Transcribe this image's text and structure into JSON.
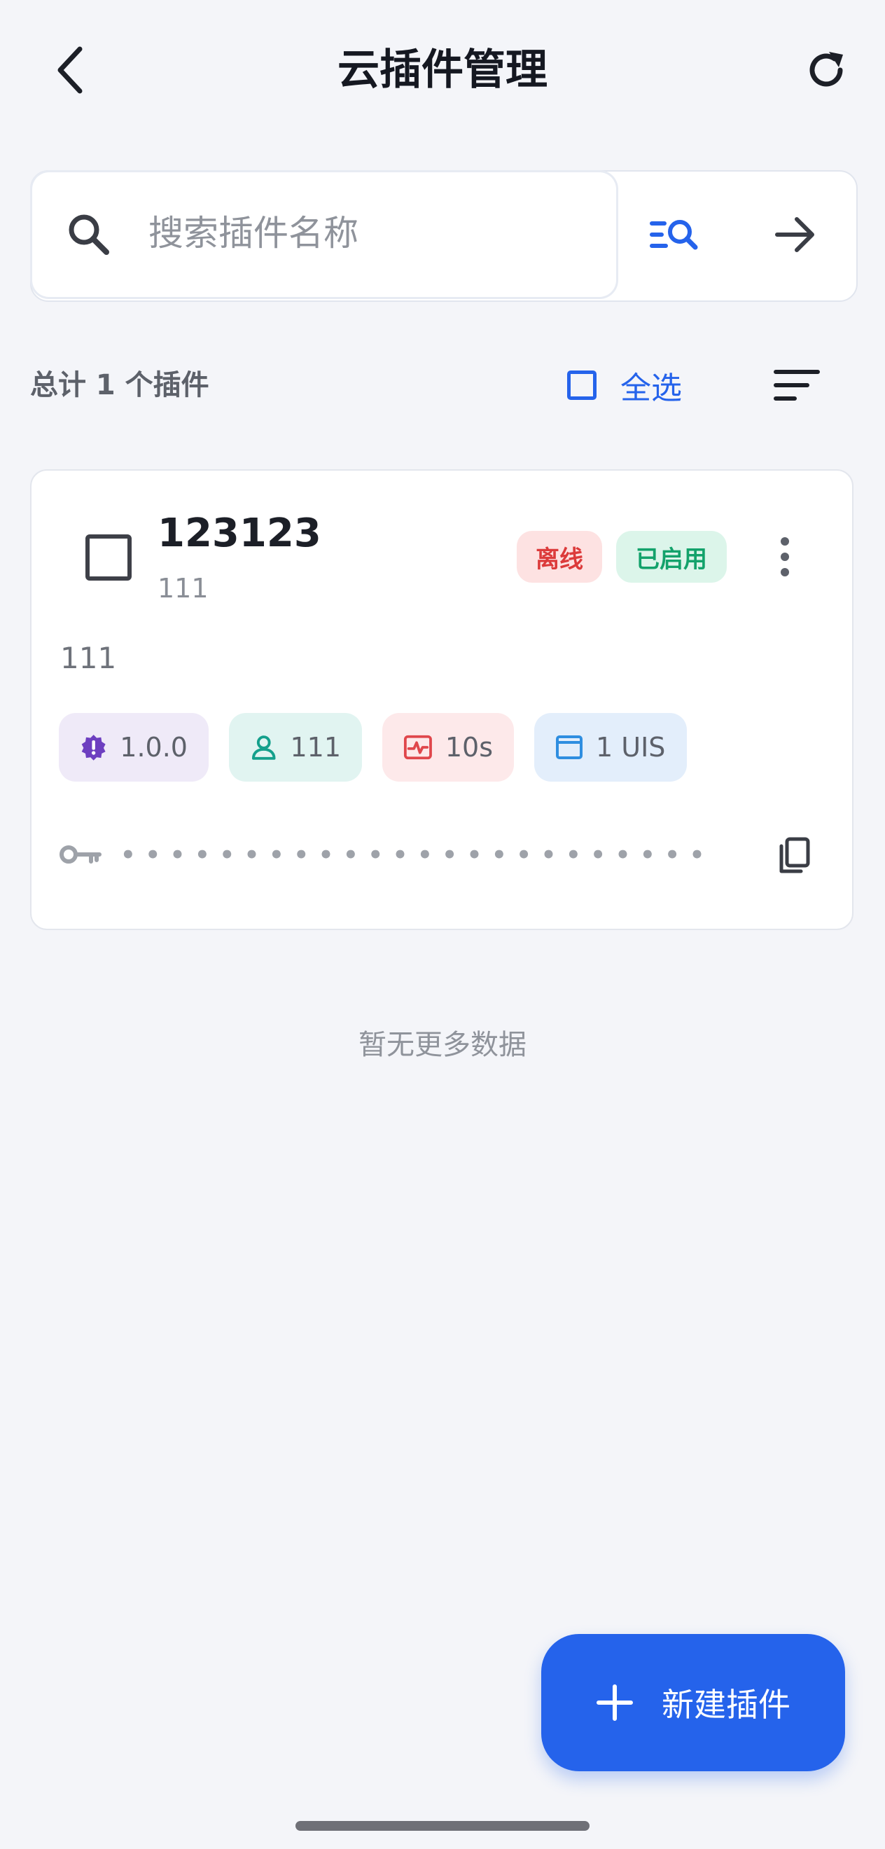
{
  "header": {
    "title": "云插件管理",
    "back_icon": "chevron-left-icon",
    "refresh_icon": "refresh-icon"
  },
  "search": {
    "placeholder": "搜索插件名称",
    "value": "",
    "advanced_icon": "list-search-icon",
    "go_icon": "arrow-right-icon"
  },
  "toolbar": {
    "total_label": "总计 1 个插件",
    "select_all_label": "全选",
    "select_all_checked": false,
    "sort_icon": "sort-icon"
  },
  "plugins": [
    {
      "name": "123123",
      "subtitle": "111",
      "description": "111",
      "badges": {
        "status": "离线",
        "enabled": "已启用"
      },
      "chips": {
        "version": "1.0.0",
        "user": "111",
        "interval": "10s",
        "uis": "1 UIS"
      },
      "key_masked": "••••••••••••••••••••••••••••••••",
      "checked": false
    }
  ],
  "list_end_text": "暂无更多数据",
  "fab": {
    "label": "新建插件"
  },
  "colors": {
    "accent": "#2563eb",
    "background": "#f4f5f9",
    "offline": "#dc3b3b",
    "enabled": "#13a26b"
  }
}
